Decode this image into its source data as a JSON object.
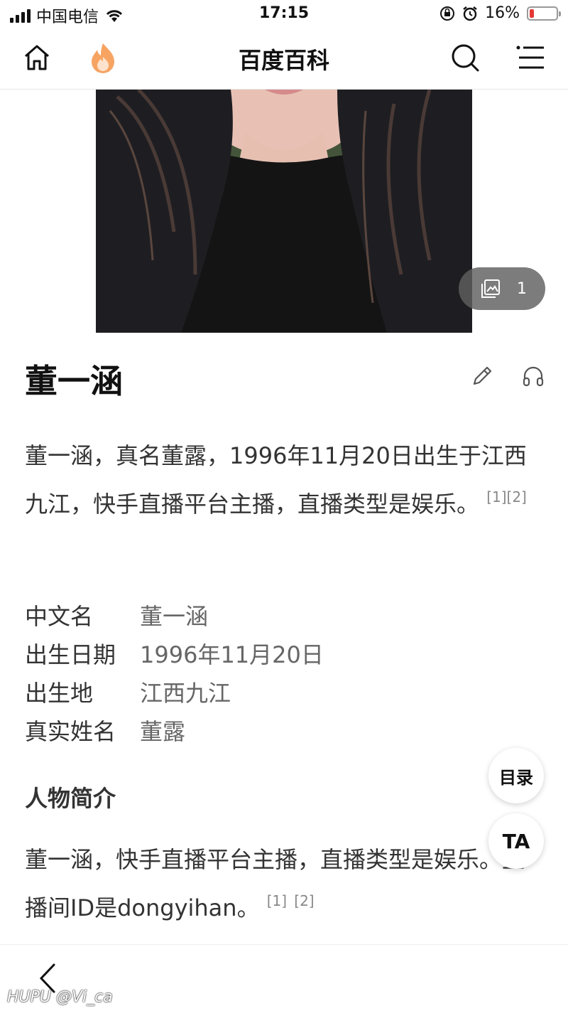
{
  "status_bar": {
    "carrier": "中国电信",
    "time": "17:15",
    "battery": "16%",
    "battery_level": 0.16,
    "battery_color": "#e53935"
  },
  "nav": {
    "title": "百度百科",
    "home_icon": "home-icon",
    "hot_icon": "flame-icon",
    "search_icon": "search-icon",
    "menu_icon": "menu-icon"
  },
  "hero": {
    "gallery_count": "1",
    "gallery_icon": "gallery-icon"
  },
  "entry": {
    "title": "董一涵",
    "summary": "董一涵，真名董露，1996年11月20日出生于江西九江，快手直播平台主播，直播类型是娱乐。",
    "summary_refs": "[1][2]"
  },
  "infobox": [
    {
      "key": "中文名",
      "value": "董一涵"
    },
    {
      "key": "出生日期",
      "value": "1996年11月20日"
    },
    {
      "key": "出生地",
      "value": "江西九江"
    },
    {
      "key": "真实姓名",
      "value": "董露"
    }
  ],
  "intro": {
    "heading": "人物简介",
    "text": "董一涵，快手直播平台主播，直播类型是娱乐。直播间ID是dongyihan。",
    "ref1": "[1]",
    "ref2": "[2]"
  },
  "floating": {
    "toc_label": "目录",
    "ta_label": "TA"
  },
  "watermark": "HUPU @Vi_ca"
}
